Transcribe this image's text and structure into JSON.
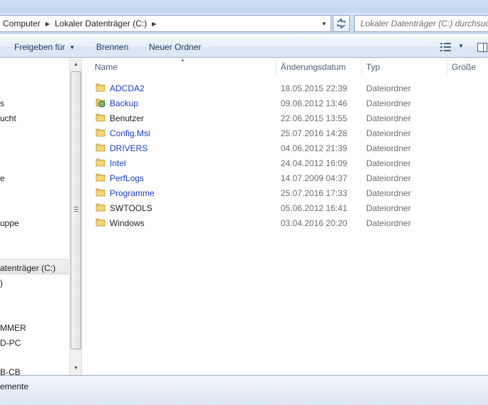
{
  "address_bar": {
    "breadcrumbs": [
      "Computer",
      "Lokaler Datenträger (C:)"
    ]
  },
  "search": {
    "placeholder": "Lokaler Datenträger (C:) durchsuchen"
  },
  "toolbar": {
    "share_label": "Freigeben für",
    "burn_label": "Brennen",
    "new_folder_label": "Neuer Ordner"
  },
  "columns": {
    "name": "Name",
    "modified": "Änderungsdatum",
    "type": "Typ",
    "size": "Größe"
  },
  "files": [
    {
      "name": "ADCDA2",
      "date": "18.05.2015 22:39",
      "type": "Dateiordner",
      "link": true,
      "icon": "folder-icon"
    },
    {
      "name": "Backup",
      "date": "09.06.2012 13:46",
      "type": "Dateiordner",
      "link": true,
      "icon": "backup-folder-icon"
    },
    {
      "name": "Benutzer",
      "date": "22.06.2015 13:55",
      "type": "Dateiordner",
      "link": false,
      "icon": "folder-icon"
    },
    {
      "name": "Config.Msi",
      "date": "25.07.2016 14:28",
      "type": "Dateiordner",
      "link": true,
      "icon": "folder-icon"
    },
    {
      "name": "DRIVERS",
      "date": "04.06.2012 21:39",
      "type": "Dateiordner",
      "link": true,
      "icon": "folder-icon"
    },
    {
      "name": "Intel",
      "date": "24.04.2012 16:09",
      "type": "Dateiordner",
      "link": true,
      "icon": "folder-icon"
    },
    {
      "name": "PerfLogs",
      "date": "14.07.2009 04:37",
      "type": "Dateiordner",
      "link": true,
      "icon": "folder-icon"
    },
    {
      "name": "Programme",
      "date": "25.07.2016 17:33",
      "type": "Dateiordner",
      "link": true,
      "icon": "folder-icon"
    },
    {
      "name": "SWTOOLS",
      "date": "05.06.2012 16:41",
      "type": "Dateiordner",
      "link": false,
      "icon": "folder-icon"
    },
    {
      "name": "Windows",
      "date": "03.04.2016 20:20",
      "type": "Dateiordner",
      "link": false,
      "icon": "folder-icon"
    }
  ],
  "nav_pane": {
    "items": [
      "s",
      "ucht",
      "e",
      "uppe",
      "atenträger (C:)",
      ")",
      "MMER",
      "D-PC",
      "B-CB"
    ],
    "selected_item": "atenträger (C:)"
  },
  "status_bar": {
    "text": "emente"
  },
  "colors": {
    "link_blue": "#1a3cc8",
    "folder_yellow": "#e8c45a",
    "header_text": "#4c607a"
  }
}
